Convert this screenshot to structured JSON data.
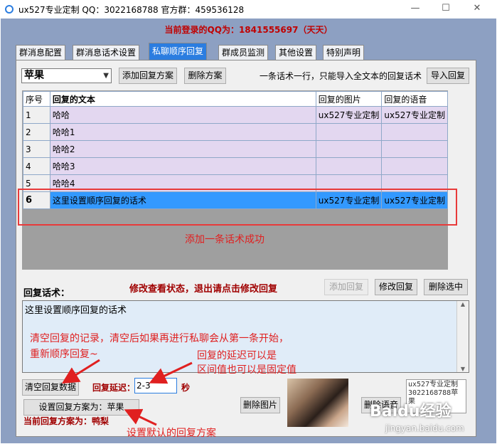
{
  "window": {
    "title": "ux527专业定制   QQ：3022168788   官方群：459536128",
    "minimize": "—",
    "maximize": "☐",
    "close": "✕"
  },
  "login_status": "当前登录的QQ为：1841555697（天天）",
  "tabs": [
    {
      "label": "群消息配置"
    },
    {
      "label": "群消息话术设置"
    },
    {
      "label": "私聊顺序回复",
      "active": true
    },
    {
      "label": "群成员监测"
    },
    {
      "label": "其他设置"
    },
    {
      "label": "特别声明"
    }
  ],
  "toolbar": {
    "scheme_selected": "苹果",
    "add_scheme": "添加回复方案",
    "delete_scheme": "删除方案",
    "hint": "一条话术一行，只能导入全文本的回复话术",
    "import_reply": "导入回复"
  },
  "table": {
    "headers": [
      "序号",
      "回复的文本",
      "回复的图片",
      "回复的语音"
    ],
    "rows": [
      {
        "idx": "1",
        "text": "哈哈",
        "image": "ux527专业定制",
        "voice": "ux527专业定制"
      },
      {
        "idx": "2",
        "text": "哈哈1",
        "image": "",
        "voice": ""
      },
      {
        "idx": "3",
        "text": "哈哈2",
        "image": "",
        "voice": ""
      },
      {
        "idx": "4",
        "text": "哈哈3",
        "image": "",
        "voice": ""
      },
      {
        "idx": "5",
        "text": "哈哈4",
        "image": "",
        "voice": ""
      },
      {
        "idx": "6",
        "text": "这里设置顺序回复的话术",
        "image": "ux527专业定制",
        "voice": "ux527专业定制",
        "selected": true
      }
    ]
  },
  "annotations": {
    "added": "添加一条话术成功",
    "clear_note_1": "清空回复的记录，清空后如果再进行私聊会从第一条开始，",
    "clear_note_2": "重新顺序回复~",
    "delay_note_1": "回复的延迟可以是",
    "delay_note_2": "区间值也可以是固定值",
    "default_note": "设置默认的回复方案"
  },
  "reply_section": {
    "label": "回复话术：",
    "edit_status": "修改查看状态，退出请点击修改回复",
    "add_reply": "添加回复",
    "modify_reply": "修改回复",
    "delete_selected": "删除选中",
    "content": "这里设置顺序回复的话术"
  },
  "bottom": {
    "clear_data": "清空回复数据",
    "delay_label": "回复延迟：",
    "delay_value": "2-3",
    "delay_unit": "秒",
    "set_scheme": "设置回复方案为：苹果",
    "current_scheme": "当前回复方案为：鸭梨",
    "delete_image": "删除图片",
    "delete_voice": "删除语音",
    "info_text": "ux527专业定制\n3022168788苹\n果"
  },
  "watermark": {
    "brand": "Baidu经验",
    "url": "jingyan.baidu.com"
  },
  "colors": {
    "accent": "#2b7de0",
    "annotation": "#e02020",
    "selection": "#3399ff",
    "row_fill": "#e3d7f0"
  }
}
